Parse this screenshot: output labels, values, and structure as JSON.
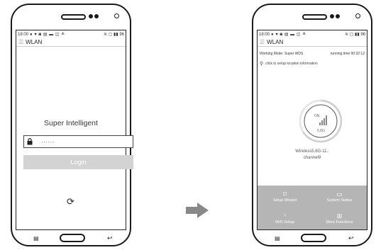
{
  "status_bar": {
    "time": "18:00",
    "icons": "● ♥ ◙ ▤ ▬ ◫ ≛",
    "right": "≋ ▢ ▮▮ 96"
  },
  "left_screen": {
    "title": "WLAN",
    "brand": "Super Intelligent",
    "password_value": "······",
    "login_label": "Login"
  },
  "right_screen": {
    "title": "WLAN",
    "working_mode": "Working Mode: Super WDS",
    "running_time": "running time 00:32:12",
    "location_prompt": "click to setup location information",
    "gauge": {
      "state": "ON",
      "band": "5.8G"
    },
    "wifi_name": "Wireless5.8G-11..",
    "channel": "channel9",
    "functions": [
      {
        "label": "Setup Wizard",
        "icon": "monitor-icon"
      },
      {
        "label": "System Status",
        "icon": "display-icon"
      },
      {
        "label": "WiFi Setup",
        "icon": "wifi-icon"
      },
      {
        "label": "More Functions",
        "icon": "grid-icon"
      }
    ]
  },
  "colors": {
    "panel_gray": "#b5b5b5",
    "button_gray": "#d3d3d3",
    "arrow_gray": "#888888"
  }
}
